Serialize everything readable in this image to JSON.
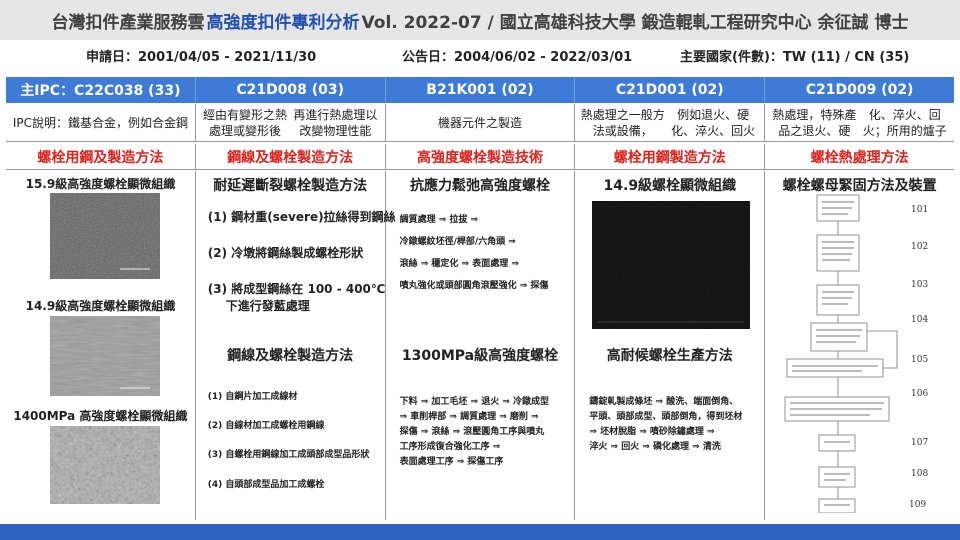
{
  "title": {
    "prefix": "台灣扣件產業服務雲",
    "highlight": "高強度扣件專利分析",
    "suffix": "Vol. 2022-07 / 國立高雄科技大學 鍛造輥軋工程研究中心 余征誠 博士"
  },
  "info": {
    "application": "申請日：2001/04/05 - 2021/11/30",
    "publication": "公告日：2004/06/02 - 2022/03/01",
    "countries": "主要國家(件數)：TW (11) / CN (35)"
  },
  "columns": [
    {
      "ipc": "主IPC：C22C038 (33)",
      "desc": [
        "IPC說明：鐵基合金，",
        "例如合金鋼"
      ],
      "category": "螺栓用鋼及製造方法"
    },
    {
      "ipc": "C21D008 (03)",
      "desc": [
        "經由有變形之熱處理或變形後",
        "再進行熱處理以改變物理性能"
      ],
      "category": "鋼線及螺栓製造方法"
    },
    {
      "ipc": "B21K001 (02)",
      "desc": [
        "機器元件之製造"
      ],
      "category": "高強度螺栓製造技術"
    },
    {
      "ipc": "C21D001 (02)",
      "desc": [
        "熱處理之一般方法或設備，",
        "例如退火、硬化、淬火、回火"
      ],
      "category": "螺栓用鋼製造方法"
    },
    {
      "ipc": "C21D009 (02)",
      "desc": [
        "熱處理，特殊產品之退火、硬",
        "化、淬火、回火；所用的爐子"
      ],
      "category": "螺栓熱處理方法"
    }
  ],
  "col1": {
    "cap1": "15.9級高強度螺栓顯微組織",
    "cap2": "14.9級高強度螺栓顯微組織",
    "cap3": "1400MPa 高強度螺栓顯微組織"
  },
  "col2": {
    "title1": "耐延遲斷裂螺栓製造方法",
    "s1a": "(1) 鋼材重(severe)拉絲得到鋼絲",
    "s2a": "(2) 冷墩將鋼絲製成螺栓形狀",
    "s3a": "(3) 將成型鋼絲在 100 - 400℃",
    "s3b": "下進行發藍處理",
    "title2": "鋼線及螺栓製造方法",
    "t1": "(1) 自鋼片加工成線材",
    "t2": "(2) 自線材加工成螺栓用鋼線",
    "t3": "(3) 自螺栓用鋼線加工成頭部成型品形狀",
    "t4": "(4) 自頭部成型品加工成螺栓"
  },
  "col3": {
    "title1": "抗應力鬆弛高強度螺栓",
    "l1": "調質處理 ⇒ 拉拔 ⇒",
    "l2": "冷鐓螺紋坯徑/桿部/六角頭 ⇒",
    "l3": "滾絲 ⇒ 穩定化 ⇒ 表面處理 ⇒",
    "l4": "噴丸強化或頭部圓角滾壓強化 ⇒ 探傷",
    "title2": "1300MPa級高強度螺栓",
    "m1": "下料 ⇒ 加工毛坯 ⇒ 退火 ⇒ 冷鐓成型",
    "m2": "⇒ 車削桿部 ⇒ 調質處理 ⇒ 磨削 ⇒",
    "m3": "探傷 ⇒ 滾絲 ⇒ 滾壓圓角工序與噴丸",
    "m4": "工序形成復合強化工序 ⇒",
    "m5": "表面處理工序 ⇒ 探傷工序"
  },
  "col4": {
    "title1": "14.9級螺栓顯微組織",
    "title2": "高耐候螺栓生產方法",
    "n1": "鑄錠軋製成條坯 ⇒ 酸洗、端面倒角、",
    "n2": "平頭、頭部成型、頭部倒角，得到坯材",
    "n3": "⇒ 坯材脫脂 ⇒ 噴砂除鏽處理 ⇒",
    "n4": "淬火 ⇒ 回火 ⇒ 磷化處理 ⇒ 清洗"
  },
  "col5": {
    "title": "螺栓螺母緊固方法及裝置",
    "steps": [
      "101",
      "102",
      "103",
      "104",
      "105",
      "106",
      "107",
      "108",
      "109"
    ]
  },
  "colors": {
    "accent": "#1f4fb0",
    "header": "#3e7bd6",
    "category": "#e0201a",
    "bottom": "#2f64c4"
  }
}
